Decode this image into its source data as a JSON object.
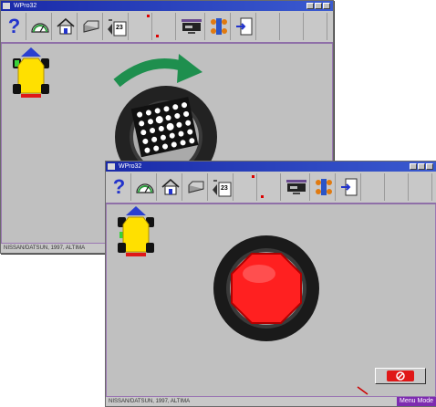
{
  "window_back": {
    "title": "WPro32",
    "status": "NISSAN/DATSUN, 1997, ALTIMA"
  },
  "window_front": {
    "title": "WPro32",
    "status": "NISSAN/DATSUN, 1997, ALTIMA",
    "mode_badge": "Menu Mode"
  },
  "toolbar": {
    "help_glyph": "?",
    "calendar_day": "23"
  },
  "icons": [
    "help-icon",
    "gauge-icon",
    "home-icon",
    "printer-icon",
    "calendar-icon",
    "monitor-icon",
    "sensor-icon",
    "document-icon"
  ],
  "colors": {
    "title_bar": "#1a2aa8",
    "accent_purple": "#8f6fa8",
    "arrow_green": "#1e8f4e",
    "wheel_target_red": "#ff2020",
    "car_yellow": "#ffe000"
  }
}
